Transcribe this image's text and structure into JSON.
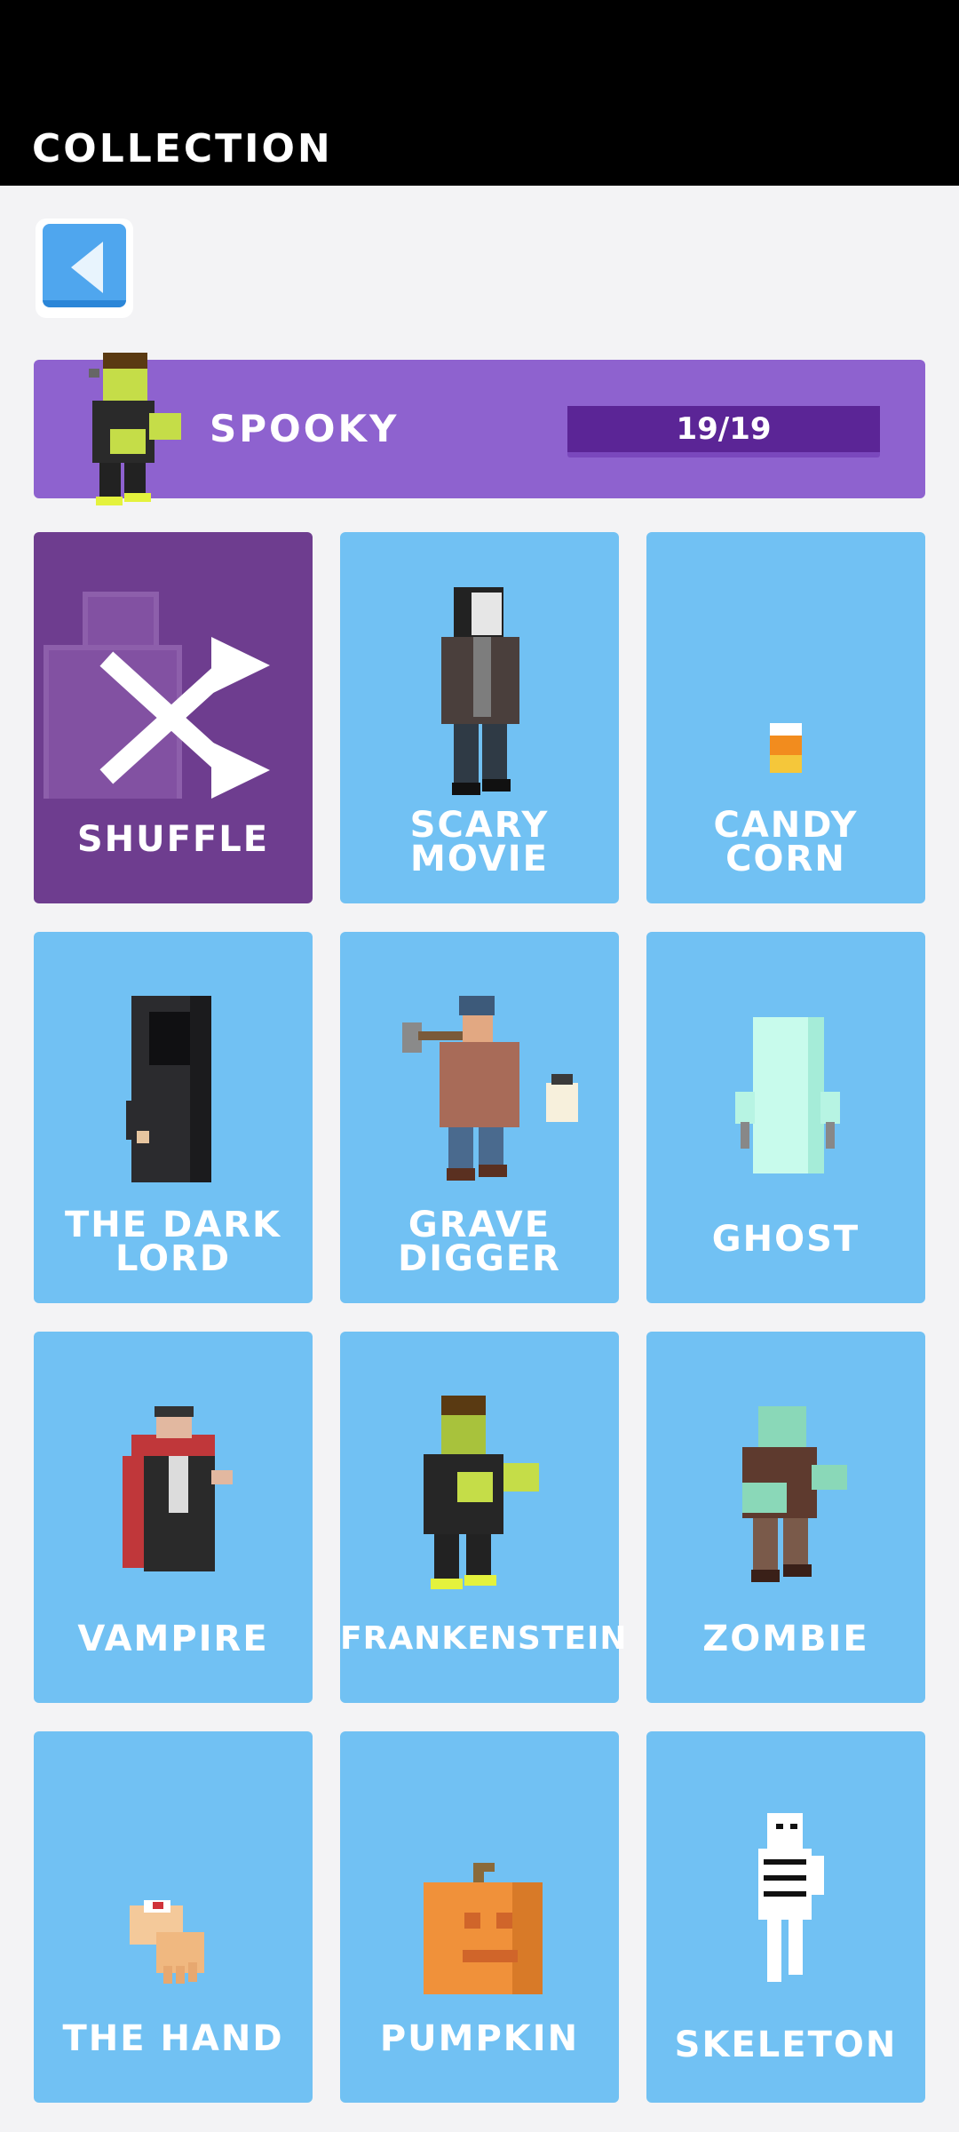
{
  "header": {
    "title": "COLLECTION"
  },
  "back_button": {
    "icon": "back-arrow-icon"
  },
  "category": {
    "name": "SPOOKY",
    "progress_text": "19/19",
    "progress_fraction": 1.0,
    "color": "#8e62cf"
  },
  "items": [
    {
      "label": "SHUFFLE",
      "icon": "shuffle-icon"
    },
    {
      "label": "SCARY MOVIE",
      "icon": "scary-movie-figure-icon"
    },
    {
      "label": "CANDY CORN",
      "icon": "candy-corn-icon"
    },
    {
      "label": "THE DARK LORD",
      "icon": "dark-lord-figure-icon"
    },
    {
      "label": "GRAVE DIGGER",
      "icon": "grave-digger-figure-icon"
    },
    {
      "label": "GHOST",
      "icon": "ghost-figure-icon"
    },
    {
      "label": "VAMPIRE",
      "icon": "vampire-figure-icon"
    },
    {
      "label": "FRANKENSTEIN",
      "icon": "frankenstein-figure-icon"
    },
    {
      "label": "ZOMBIE",
      "icon": "zombie-figure-icon"
    },
    {
      "label": "THE HAND",
      "icon": "hand-figure-icon"
    },
    {
      "label": "PUMPKIN",
      "icon": "pumpkin-icon"
    },
    {
      "label": "SKELETON",
      "icon": "skeleton-figure-icon"
    }
  ]
}
